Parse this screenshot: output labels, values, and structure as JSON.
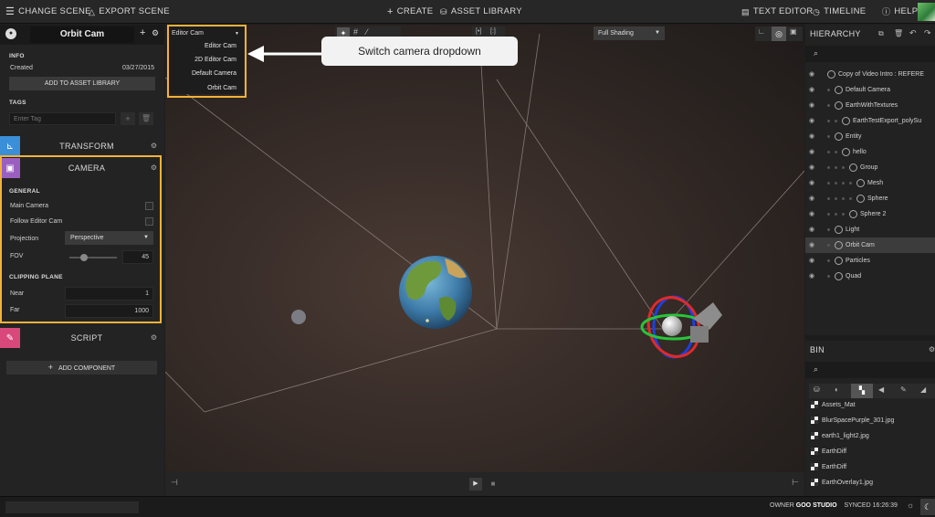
{
  "topbar": {
    "change_scene": "CHANGE SCENE",
    "export_scene": "EXPORT SCENE",
    "create": "CREATE",
    "asset_library": "ASSET LIBRARY",
    "text_editor": "TEXT EDITOR",
    "timeline": "TIMELINE",
    "help": "HELP"
  },
  "inspector": {
    "entity_name": "Orbit Cam",
    "info_title": "INFO",
    "created_label": "Created",
    "created_value": "03/27/2015",
    "add_to_asset_library": "ADD TO ASSET LIBRARY",
    "tags_title": "TAGS",
    "tag_placeholder": "Enter Tag",
    "components": {
      "transform": "TRANSFORM",
      "camera": "CAMERA",
      "script": "SCRIPT"
    },
    "camera": {
      "general_title": "GENERAL",
      "main_camera": "Main Camera",
      "follow_editor_cam": "Follow Editor Cam",
      "projection_label": "Projection",
      "projection_value": "Perspective",
      "fov_label": "FOV",
      "fov_value": "45",
      "fov_fraction": 0.27,
      "clipping_title": "CLIPPING PLANE",
      "near_label": "Near",
      "near_value": "1",
      "far_label": "Far",
      "far_value": "1000"
    },
    "add_component": "ADD COMPONENT"
  },
  "viewport": {
    "camera_dropdown": {
      "selected": "Editor Cam",
      "options": [
        "Editor Cam",
        "2D Editor Cam",
        "Default Camera",
        "Orbit Cam"
      ]
    },
    "shading": "Full Shading",
    "callout": "Switch camera dropdown"
  },
  "hierarchy": {
    "title": "HIERARCHY",
    "items": [
      {
        "label": "Copy of Video Intro : REFERE",
        "depth": 0
      },
      {
        "label": "Default Camera",
        "depth": 1
      },
      {
        "label": "EarthWithTextures",
        "depth": 1
      },
      {
        "label": "EarthTestExport_polySu",
        "depth": 2
      },
      {
        "label": "Entity",
        "depth": 1
      },
      {
        "label": "hello",
        "depth": 2
      },
      {
        "label": "Group",
        "depth": 3
      },
      {
        "label": "Mesh",
        "depth": 4
      },
      {
        "label": "Sphere",
        "depth": 4
      },
      {
        "label": "Sphere 2",
        "depth": 3
      },
      {
        "label": "Light",
        "depth": 1
      },
      {
        "label": "Orbit Cam",
        "depth": 1
      },
      {
        "label": "Particles",
        "depth": 1
      },
      {
        "label": "Quad",
        "depth": 1
      }
    ]
  },
  "bin": {
    "title": "BIN",
    "items": [
      "Assets_Mat",
      "BlurSpacePurple_301.jpg",
      "earth1_light2.jpg",
      "EarthDiff",
      "EarthDiff",
      "EarthOverlay1.jpg"
    ]
  },
  "status": {
    "owner_label": "OWNER",
    "owner_value": "GOO STUDIO",
    "synced": "SYNCED 16:26:39"
  },
  "colors": {
    "highlight": "#f4b23a",
    "transform": "#3a8fd8",
    "camera": "#9b5fc0",
    "script": "#d9487a"
  }
}
